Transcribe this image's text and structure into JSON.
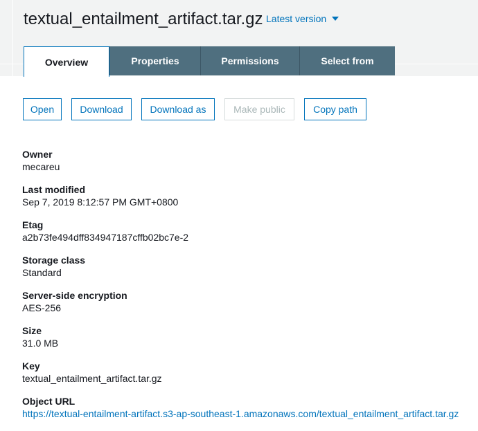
{
  "object": {
    "title": "textual_entailment_artifact.tar.gz",
    "version_label": "Latest version"
  },
  "tabs": [
    {
      "label": "Overview"
    },
    {
      "label": "Properties"
    },
    {
      "label": "Permissions"
    },
    {
      "label": "Select from"
    }
  ],
  "actions": {
    "open": "Open",
    "download": "Download",
    "download_as": "Download as",
    "make_public": "Make public",
    "copy_path": "Copy path"
  },
  "properties": {
    "owner": {
      "label": "Owner",
      "value": "mecareu"
    },
    "last_modified": {
      "label": "Last modified",
      "value": "Sep 7, 2019 8:12:57 PM GMT+0800"
    },
    "etag": {
      "label": "Etag",
      "value": "a2b73fe494dff834947187cffb02bc7e-2"
    },
    "storage_class": {
      "label": "Storage class",
      "value": "Standard"
    },
    "encryption": {
      "label": "Server-side encryption",
      "value": "AES-256"
    },
    "size": {
      "label": "Size",
      "value": "31.0 MB"
    },
    "key": {
      "label": "Key",
      "value": "textual_entailment_artifact.tar.gz"
    },
    "url": {
      "label": "Object URL",
      "value": "https://textual-entailment-artifact.s3-ap-southeast-1.amazonaws.com/textual_entailment_artifact.tar.gz"
    }
  },
  "colors": {
    "accent": "#0073bb",
    "tab_inactive": "#4f6f7f",
    "header_bg": "#f2f3f3",
    "disabled": "#aab7b8"
  }
}
